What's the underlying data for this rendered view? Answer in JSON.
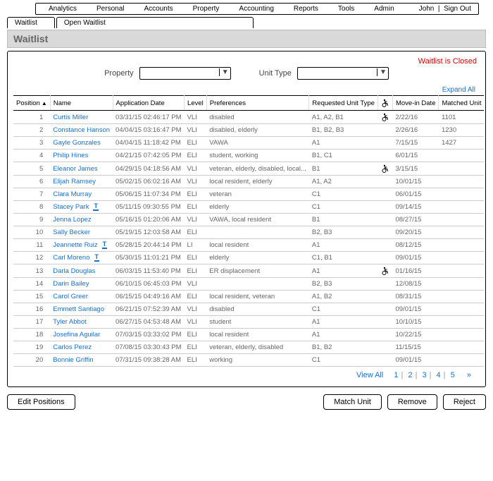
{
  "nav": {
    "items": [
      "Analytics",
      "Personal",
      "Accounts",
      "Property",
      "Accounting",
      "Reports",
      "Tools",
      "Admin"
    ],
    "user": "John",
    "signout": "Sign Out"
  },
  "tabs": {
    "tab1": "Waitlist",
    "tab2": "Open Waitlist"
  },
  "page": {
    "title": "Waitlist",
    "status": "Waitlist is Closed",
    "filters": {
      "property_label": "Property",
      "unittype_label": "Unit Type"
    },
    "expand_all": "Expand All"
  },
  "columns": {
    "position": "Position",
    "name": "Name",
    "appdate": "Application Date",
    "level": "Level",
    "prefs": "Preferences",
    "req": "Requested Unit Type",
    "acc": "",
    "movein": "Move-in Date",
    "matched": "Matched Unit"
  },
  "icons": {
    "wheelchair_label": "♿",
    "sort_indicator": "▲"
  },
  "rows": [
    {
      "pos": "1",
      "name": "Curtis Miller",
      "t": false,
      "app": "03/31/15 02:46:17 PM",
      "lvl": "VLI",
      "pref": "disabled",
      "req": "A1, A2, B1",
      "acc": true,
      "move": "2/22/16",
      "match": "1101"
    },
    {
      "pos": "2",
      "name": "Constance Hanson",
      "t": false,
      "app": "04/04/15 03:16:47 PM",
      "lvl": "VLI",
      "pref": "disabled, elderly",
      "req": "B1, B2, B3",
      "acc": false,
      "move": "2/26/16",
      "match": "1230"
    },
    {
      "pos": "3",
      "name": "Gayle Gonzales",
      "t": false,
      "app": "04/04/15 11:18:42 PM",
      "lvl": "ELI",
      "pref": "VAWA",
      "req": "A1",
      "acc": false,
      "move": "7/15/15",
      "match": "1427"
    },
    {
      "pos": "4",
      "name": "Philip Hines",
      "t": false,
      "app": "04/21/15 07:42:05 PM",
      "lvl": "ELI",
      "pref": "student, working",
      "req": "B1, C1",
      "acc": false,
      "move": "6/01/15",
      "match": ""
    },
    {
      "pos": "5",
      "name": "Eleanor James",
      "t": false,
      "app": "04/29/15 04:18:56 AM",
      "lvl": "VLI",
      "pref": "veteran, elderly, disabled, local...",
      "req": "B1",
      "acc": true,
      "move": "3/15/15",
      "match": ""
    },
    {
      "pos": "6",
      "name": "Elijah Ramsey",
      "t": false,
      "app": "05/02/15 06:02:16 AM",
      "lvl": "VLI",
      "pref": "local resident, elderly",
      "req": "A1, A2",
      "acc": false,
      "move": "10/01/15",
      "match": ""
    },
    {
      "pos": "7",
      "name": "Clara Murray",
      "t": false,
      "app": "05/06/15 11:07:34 PM",
      "lvl": "ELI",
      "pref": "veteran",
      "req": "C1",
      "acc": false,
      "move": "06/01/15",
      "match": ""
    },
    {
      "pos": "8",
      "name": "Stacey Park",
      "t": true,
      "app": "05/11/15 09:30:55 PM",
      "lvl": "ELI",
      "pref": "elderly",
      "req": "C1",
      "acc": false,
      "move": "09/14/15",
      "match": ""
    },
    {
      "pos": "9",
      "name": "Jenna Lopez",
      "t": false,
      "app": "05/16/15 01:20:06 AM",
      "lvl": "VLI",
      "pref": "VAWA, local resident",
      "req": "B1",
      "acc": false,
      "move": "08/27/15",
      "match": ""
    },
    {
      "pos": "10",
      "name": "Sally Becker",
      "t": false,
      "app": "05/19/15 12:03:58 AM",
      "lvl": "ELI",
      "pref": "",
      "req": "B2, B3",
      "acc": false,
      "move": "09/20/15",
      "match": ""
    },
    {
      "pos": "11",
      "name": "Jeannette Ruiz",
      "t": true,
      "app": "05/28/15 20:44:14 PM",
      "lvl": "LI",
      "pref": "local resident",
      "req": "A1",
      "acc": false,
      "move": "08/12/15",
      "match": ""
    },
    {
      "pos": "12",
      "name": "Carl Moreno",
      "t": true,
      "app": "05/30/15 11:01:21 PM",
      "lvl": "ELI",
      "pref": "elderly",
      "req": "C1, B1",
      "acc": false,
      "move": "09/01/15",
      "match": ""
    },
    {
      "pos": "13",
      "name": "Darla Douglas",
      "t": false,
      "app": "06/03/15 11:53:40 PM",
      "lvl": "ELI",
      "pref": "ER displacement",
      "req": "A1",
      "acc": true,
      "move": "01/16/15",
      "match": ""
    },
    {
      "pos": "14",
      "name": "Darin Bailey",
      "t": false,
      "app": "06/10/15 06:45:03 PM",
      "lvl": "VLI",
      "pref": "",
      "req": "B2, B3",
      "acc": false,
      "move": "12/08/15",
      "match": ""
    },
    {
      "pos": "15",
      "name": "Carol Greer",
      "t": false,
      "app": "06/15/15 04:49:16 AM",
      "lvl": "ELI",
      "pref": "local resident, veteran",
      "req": "A1, B2",
      "acc": false,
      "move": "08/31/15",
      "match": ""
    },
    {
      "pos": "16",
      "name": "Emmett Santiago",
      "t": false,
      "app": "06/21/15 07:52:39 AM",
      "lvl": "VLI",
      "pref": "disabled",
      "req": "C1",
      "acc": false,
      "move": "09/01/15",
      "match": ""
    },
    {
      "pos": "17",
      "name": "Tyler Abbot",
      "t": false,
      "app": "06/27/15 04:53:48 AM",
      "lvl": "VLI",
      "pref": "student",
      "req": "A1",
      "acc": false,
      "move": "10/10/15",
      "match": ""
    },
    {
      "pos": "18",
      "name": "Josefina Aguilar",
      "t": false,
      "app": "07/03/15 03:33:02 PM",
      "lvl": "ELI",
      "pref": "local resident",
      "req": "A1",
      "acc": false,
      "move": "10/22/15",
      "match": ""
    },
    {
      "pos": "19",
      "name": "Carlos Perez",
      "t": false,
      "app": "07/08/15 03:30:43 PM",
      "lvl": "ELI",
      "pref": "veteran, elderly, disabled",
      "req": "B1, B2",
      "acc": false,
      "move": "11/15/15",
      "match": ""
    },
    {
      "pos": "20",
      "name": "Bonnie Griffin",
      "t": false,
      "app": "07/31/15 09:38:28 AM",
      "lvl": "ELI",
      "pref": "working",
      "req": "C1",
      "acc": false,
      "move": "09/01/15",
      "match": ""
    }
  ],
  "pager": {
    "viewall": "View All",
    "pages": [
      "1",
      "2",
      "3",
      "4",
      "5"
    ],
    "next": "»"
  },
  "buttons": {
    "edit": "Edit Positions",
    "match": "Match Unit",
    "remove": "Remove",
    "reject": "Reject"
  }
}
